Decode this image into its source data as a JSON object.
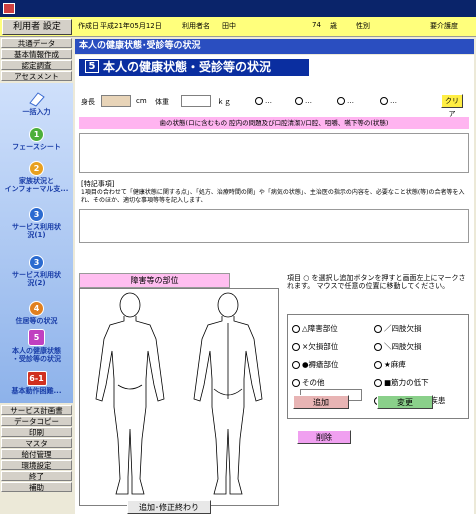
{
  "info": {
    "user_setting": "利用者 設定",
    "created_label": "作成日",
    "created_date": "平成21年05月12日",
    "user_label": "利用者名",
    "user_name": "田中",
    "age": "74",
    "age_unit": "歳",
    "gender_label": "性別",
    "care_level_label": "要介護度"
  },
  "sidebar": {
    "top_items": [
      "共通データ",
      "基本情報作成",
      "認定調査",
      "アセスメント"
    ],
    "steps": [
      {
        "badge": "",
        "label": "一括入力",
        "color": "#ffffff"
      },
      {
        "badge": "1",
        "label": "フェースシート",
        "color": "#4caf3a"
      },
      {
        "badge": "2",
        "label": "家族状況と\nインフォーマル支...",
        "color": "#e8a020"
      },
      {
        "badge": "3",
        "label": "サービス利用状\n況(1)",
        "color": "#2a6ad0"
      },
      {
        "badge": "3",
        "label": "サービス利用状\n況(2)",
        "color": "#2a6ad0"
      },
      {
        "badge": "4",
        "label": "住居等の状況",
        "color": "#e08020"
      },
      {
        "badge": "5",
        "label": "本人の健康状態\n・受診等の状況",
        "color": "#c040c0"
      },
      {
        "badge": "6-1",
        "label": "基本動作困難...",
        "color": "#d03020"
      }
    ],
    "bottom_items": [
      "サービス計画書",
      "データコピー",
      "印刷",
      "マスタ",
      "給付管理",
      "環境設定",
      "終了",
      "補助"
    ]
  },
  "main": {
    "header": "本人の健康状態･受診等の状況",
    "section_number": "5",
    "section_title": "本人の健康状態・受診等の状況",
    "height_label": "身長",
    "height_unit": "cm",
    "weight_label": "体重",
    "weight_unit": "ｋｇ",
    "clear_button": "クリア",
    "pink_bar_text": "歯の状態(ロに含むもの 腔内の問題及び口腔清潔)/口腔、咀嚼、嚥下等の(状態)",
    "special_notes_label": "[特記事項]",
    "special_notes_text": "1項目の合わせて「健康状態に関する点」、「処方、治療時間の関」や「病気の状態」、主治医の指示の内容を、必要なこと状態(等)の合者等を入れ、そのほか、適切な事項等等を記入します、",
    "body_parts_title": "障害等の部位",
    "instruction": "項目 ○ を選択し追加ボタンを押すと画面左上にマークされます。 マウスで任意の位置に移動してください。",
    "options_left": [
      "△障害部位",
      "×欠損部位",
      "●褥瘡部位",
      "その他"
    ],
    "options_right": [
      "／四肢欠損",
      "＼四肢欠損",
      "★麻痺",
      "■筋力の低下",
      "◎その 他皮膚疾患"
    ],
    "add_button": "追加",
    "change_button": "変更",
    "delete_button": "削除",
    "finish_button": "追加･修正終わり"
  },
  "colors": {
    "title_bar": "#0a246a",
    "info_bar": "#ffff7c",
    "header_blue": "#2a4ec0",
    "pink": "#ffb4f0",
    "add_button": "#e8b4b4",
    "change_button": "#8ad08a",
    "delete_button": "#f0a0f0"
  }
}
